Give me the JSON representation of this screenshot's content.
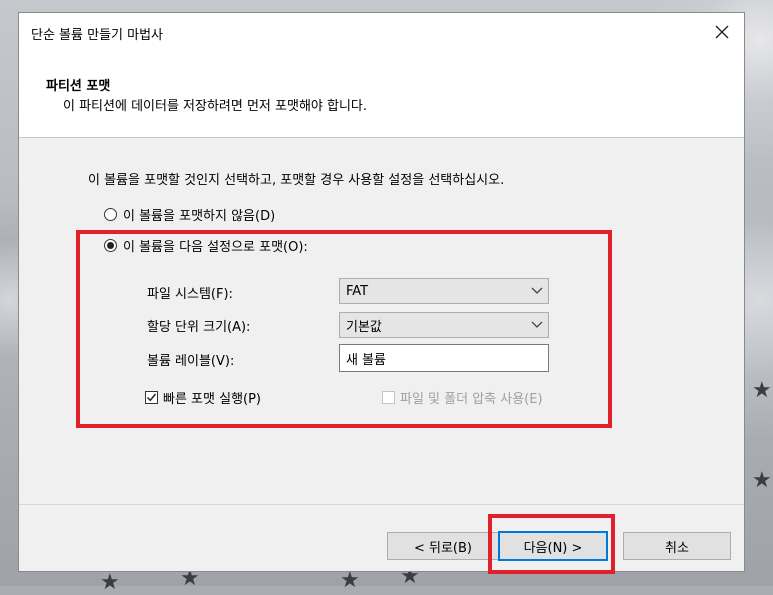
{
  "window": {
    "title": "단순 볼륨 만들기 마법사"
  },
  "header": {
    "title": "파티션 포맷",
    "subtitle": "이 파티션에 데이터를 저장하려면 먼저 포맷해야 합니다."
  },
  "body": {
    "instruction": "이 볼륨을 포맷할 것인지 선택하고, 포맷할 경우 사용할 설정을 선택하십시오.",
    "radio_no_format": {
      "label": "이 볼륨을 포맷하지 않음(D)",
      "selected": false
    },
    "radio_format": {
      "label": "이 볼륨을 다음 설정으로 포맷(O):",
      "selected": true
    },
    "file_system": {
      "label": "파일 시스템(F):",
      "value": "FAT"
    },
    "allocation_unit": {
      "label": "할당 단위 크기(A):",
      "value": "기본값"
    },
    "volume_label": {
      "label": "볼륨 레이블(V):",
      "value": "새 볼륨"
    },
    "quick_format": {
      "label": "빠른 포맷 실행(P)",
      "checked": true
    },
    "compression": {
      "label": "파일 및 폴더 압축 사용(E)",
      "checked": false,
      "enabled": false
    }
  },
  "footer": {
    "back_label": "< 뒤로(B)",
    "next_label": "다음(N) >",
    "cancel_label": "취소"
  },
  "colors": {
    "highlight": "#e0202a",
    "accent": "#0078d7"
  }
}
